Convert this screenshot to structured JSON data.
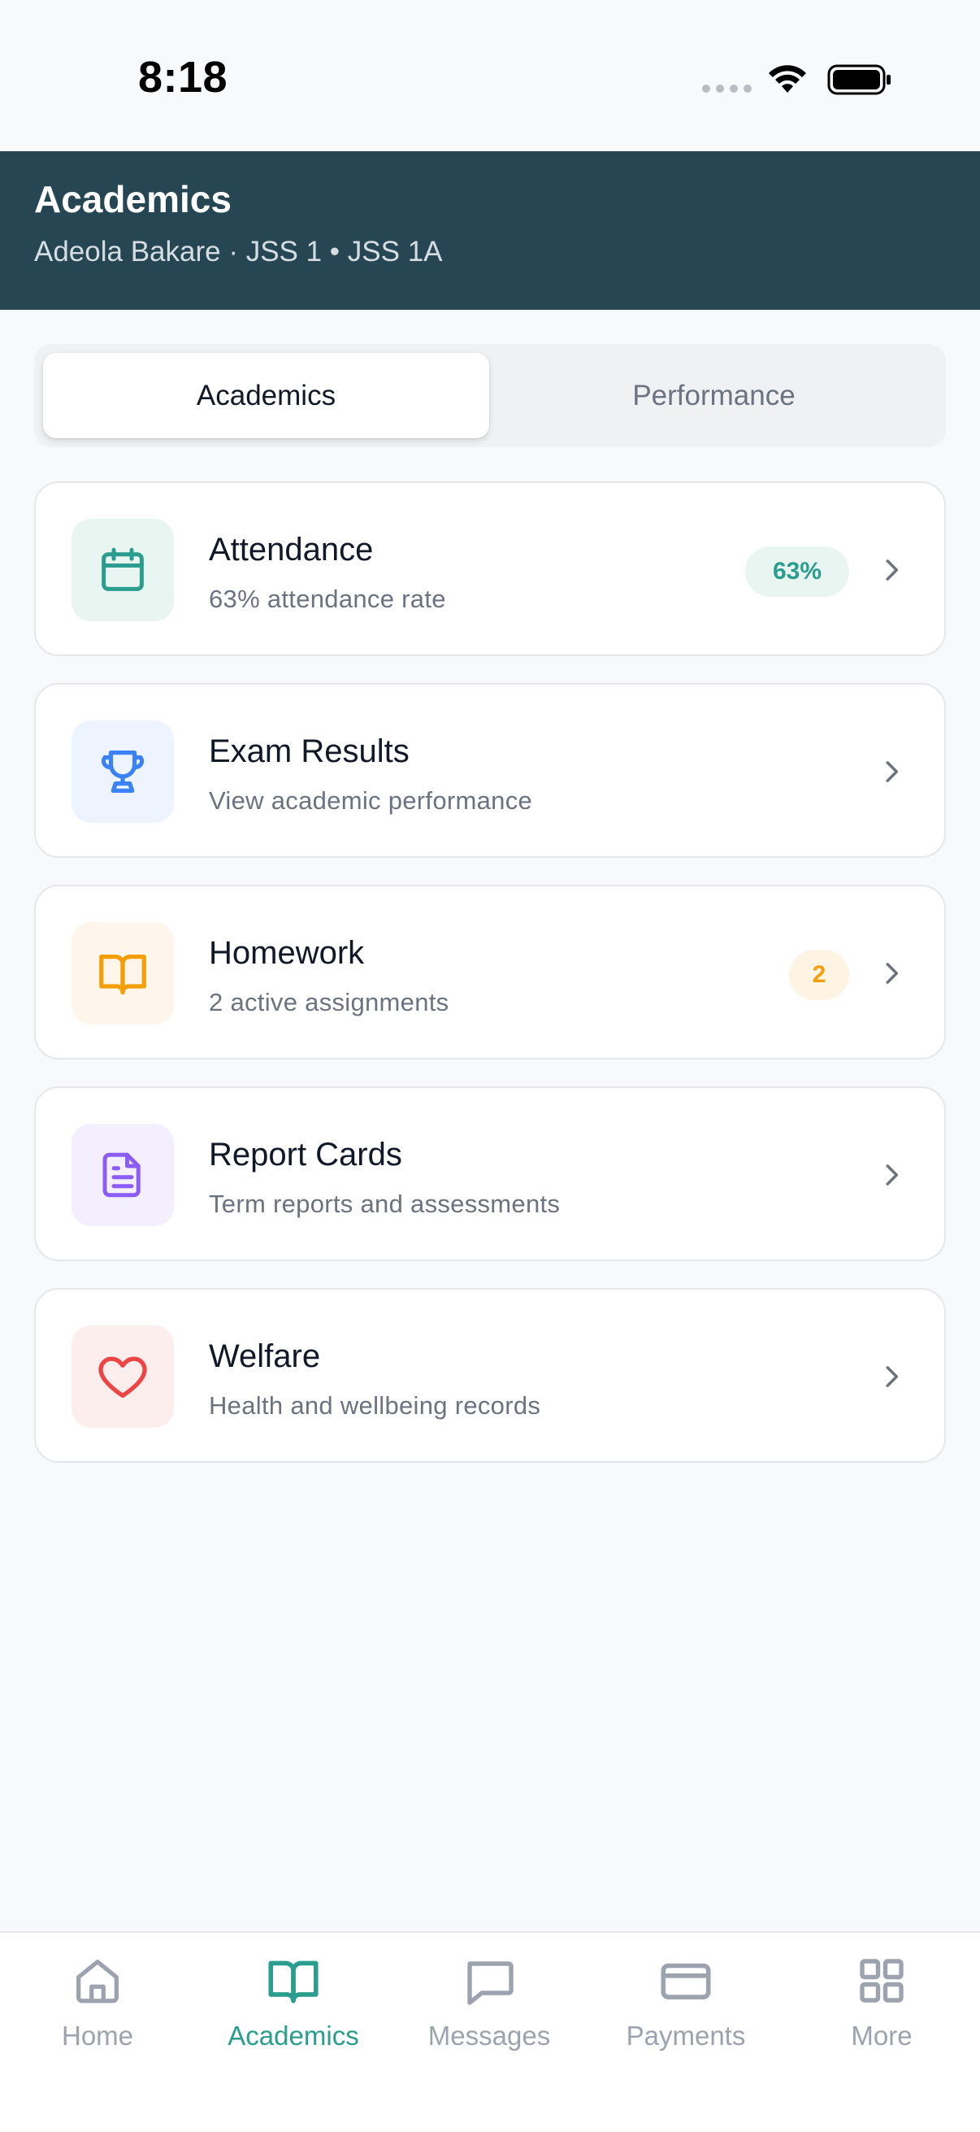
{
  "status_bar": {
    "time": "8:18"
  },
  "header": {
    "title": "Academics",
    "subtitle": "Adeola Bakare · JSS 1 • JSS 1A"
  },
  "segmented": {
    "tabs": [
      {
        "label": "Academics",
        "selected": true
      },
      {
        "label": "Performance",
        "selected": false
      }
    ]
  },
  "items": [
    {
      "title": "Attendance",
      "subtitle": "63% attendance rate",
      "badge": "63%",
      "icon": "calendar-icon",
      "color": "#2a9d8f"
    },
    {
      "title": "Exam Results",
      "subtitle": "View academic performance",
      "icon": "trophy-icon",
      "color": "#3b82f6"
    },
    {
      "title": "Homework",
      "subtitle": "2 active assignments",
      "badge": "2",
      "icon": "book-open-icon",
      "color": "#f59e0b"
    },
    {
      "title": "Report Cards",
      "subtitle": "Term reports and assessments",
      "icon": "document-icon",
      "color": "#8b5cf6"
    },
    {
      "title": "Welfare",
      "subtitle": "Health and wellbeing records",
      "icon": "heart-icon",
      "color": "#ef4444"
    }
  ],
  "tabbar": {
    "tabs": [
      {
        "label": "Home",
        "icon": "home-icon",
        "active": false
      },
      {
        "label": "Academics",
        "icon": "book-open-icon",
        "active": true
      },
      {
        "label": "Messages",
        "icon": "message-icon",
        "active": false
      },
      {
        "label": "Payments",
        "icon": "credit-card-icon",
        "active": false
      },
      {
        "label": "More",
        "icon": "grid-icon",
        "active": false
      }
    ]
  },
  "colors": {
    "header_bg": "#264653",
    "accent": "#2a9d8f",
    "page_bg": "#f8f9fb"
  }
}
